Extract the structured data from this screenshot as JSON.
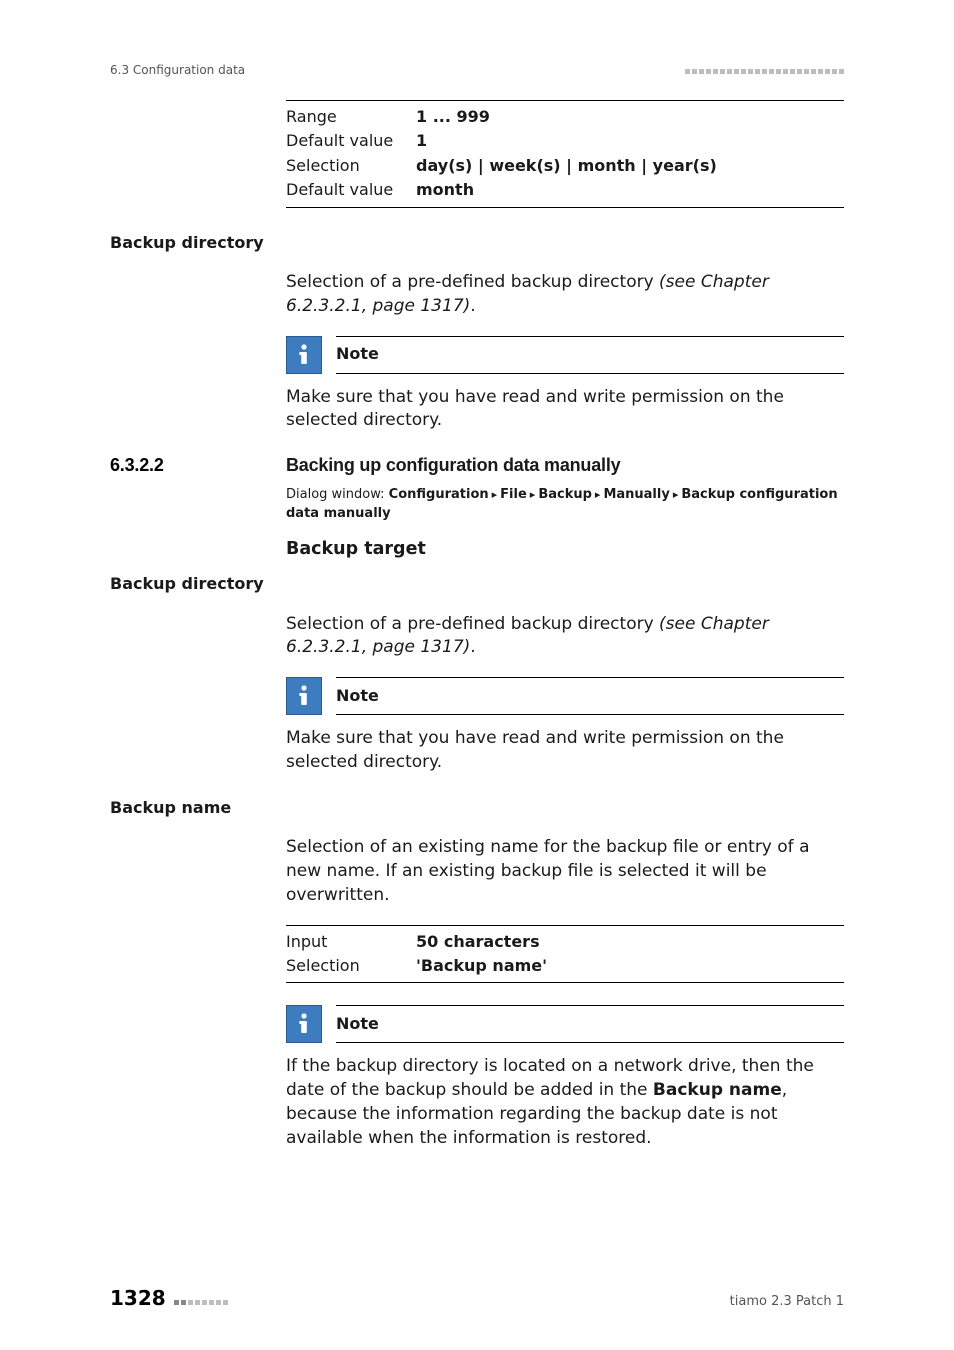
{
  "running_head": {
    "left": "6.3 Configuration data"
  },
  "spec_top": {
    "rows": [
      {
        "k": "Range",
        "v": "1 ... 999"
      },
      {
        "k": "Default value",
        "v": "1"
      },
      {
        "k": "Selection",
        "v": "day(s) | week(s) | month | year(s)"
      },
      {
        "k": "Default value",
        "v": "month"
      }
    ]
  },
  "backup_dir_1": {
    "label": "Backup directory",
    "text_a": "Selection of a pre-defined backup directory ",
    "text_b": "(see Chapter 6.2.3.2.1, page 1317)",
    "text_c": "."
  },
  "note_common": {
    "title": "Note",
    "perm_text": "Make sure that you have read and write permission on the selected directory."
  },
  "section": {
    "num": "6.3.2.2",
    "title": "Backing up configuration data manually"
  },
  "dialog": {
    "prefix": "Dialog window: ",
    "parts": [
      "Configuration",
      "File",
      "Backup",
      "Manually",
      "Backup configuration data manually"
    ]
  },
  "backup_target_h": "Backup target",
  "backup_dir_2": {
    "label": "Backup directory",
    "text_a": "Selection of a pre-defined backup directory ",
    "text_b": "(see Chapter 6.2.3.2.1, page 1317)",
    "text_c": "."
  },
  "backup_name": {
    "label": "Backup name",
    "desc": "Selection of an existing name for the backup file or entry of a new name. If an existing backup file is selected it will be overwritten.",
    "spec": {
      "rows": [
        {
          "k": "Input",
          "v": "50 characters"
        },
        {
          "k": "Selection",
          "v": "'Backup name'"
        }
      ]
    }
  },
  "note_network": {
    "text_a": "If the backup directory is located on a network drive, then the date of the backup should be added in the ",
    "text_b": "Backup name",
    "text_c": ", because the information regarding the backup date is not available when the information is restored."
  },
  "footer": {
    "page": "1328",
    "right": "tiamo 2.3 Patch 1"
  }
}
